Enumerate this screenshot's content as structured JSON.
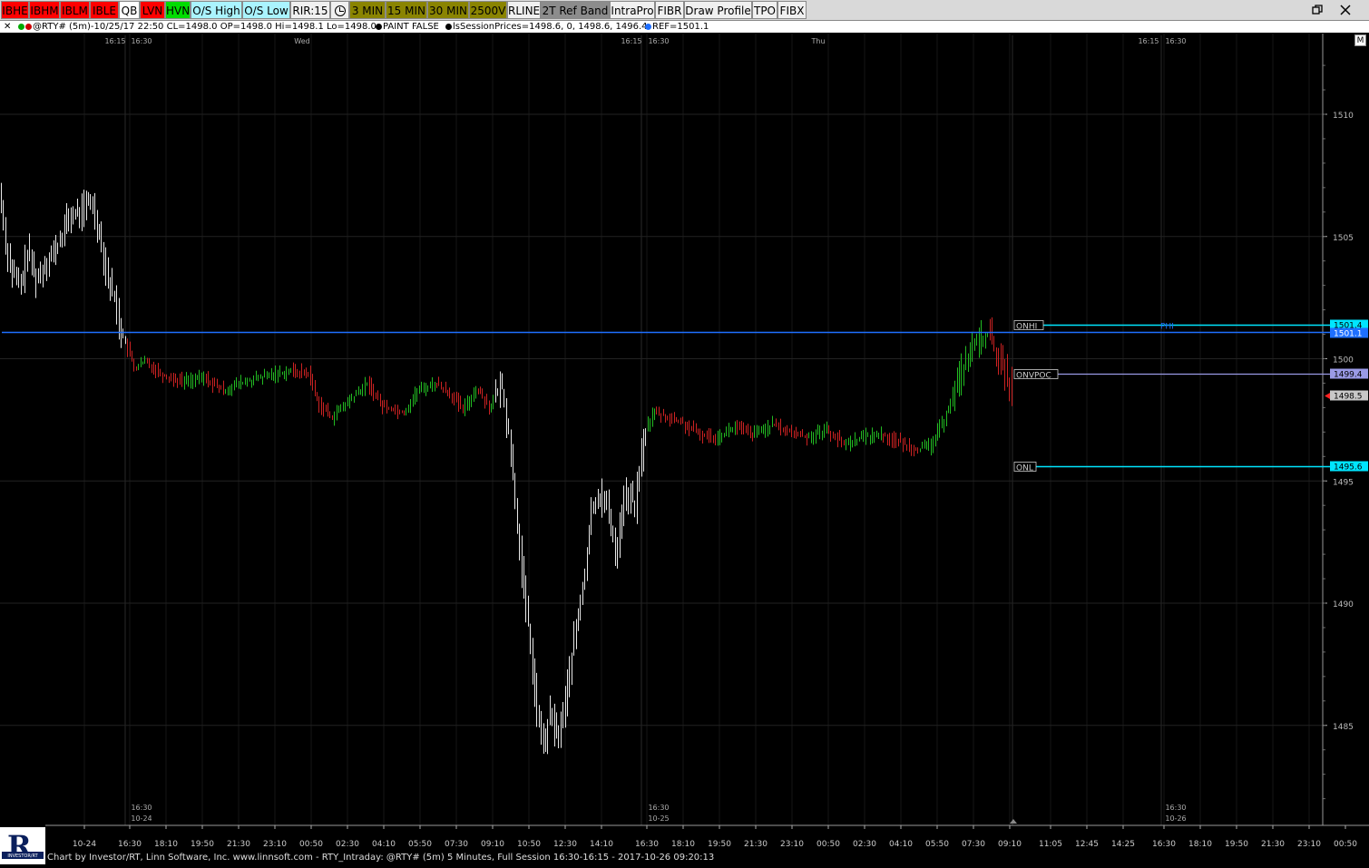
{
  "toolbar": {
    "buttons": [
      {
        "label": "IBHE",
        "bg": "#ff0000",
        "fg": "#000000"
      },
      {
        "label": "IBHM",
        "bg": "#ff0000",
        "fg": "#000000"
      },
      {
        "label": "IBLM",
        "bg": "#ff0000",
        "fg": "#000000"
      },
      {
        "label": "IBLE",
        "bg": "#ff0000",
        "fg": "#000000"
      },
      {
        "label": "QB",
        "bg": "#ffffff",
        "fg": "#000000"
      },
      {
        "label": "LVN",
        "bg": "#ff0000",
        "fg": "#000000"
      },
      {
        "label": "HVN",
        "bg": "#00dd00",
        "fg": "#000000"
      },
      {
        "label": "O/S High",
        "bg": "#aaf4ff",
        "fg": "#000000"
      },
      {
        "label": "O/S Low",
        "bg": "#aaf4ff",
        "fg": "#000000"
      },
      {
        "label": "RIR:15",
        "bg": "#f0f0f0",
        "fg": "#000000"
      },
      {
        "label": "",
        "bg": "#f0f0f0",
        "fg": "#000000",
        "icon": "clock-icon"
      },
      {
        "label": "3 MIN",
        "bg": "#8a8400",
        "fg": "#000000"
      },
      {
        "label": "15 MIN",
        "bg": "#8a8400",
        "fg": "#000000"
      },
      {
        "label": "30 MIN",
        "bg": "#8a8400",
        "fg": "#000000"
      },
      {
        "label": "2500V",
        "bg": "#8a8400",
        "fg": "#000000"
      },
      {
        "label": "RLINE",
        "bg": "#f0f0f0",
        "fg": "#000000"
      },
      {
        "label": "2T Ref Band",
        "bg": "#8c8c8c",
        "fg": "#000000"
      },
      {
        "label": "IntraPro",
        "bg": "#f0f0f0",
        "fg": "#000000"
      },
      {
        "label": "FIBR",
        "bg": "#f0f0f0",
        "fg": "#000000"
      },
      {
        "label": "Draw Profile",
        "bg": "#f0f0f0",
        "fg": "#000000"
      },
      {
        "label": "TPO",
        "bg": "#f0f0f0",
        "fg": "#000000"
      },
      {
        "label": "FIBX",
        "bg": "#f0f0f0",
        "fg": "#000000"
      }
    ],
    "restore_icon": "restore-window-icon",
    "close_icon": "close-icon"
  },
  "infobar": {
    "close_glyph": "✕",
    "symbol_text": "@RTY# (5m)-10/25/17 22:50 CL=1498.0 OP=1498.0 Hi=1498.1 Lo=1498.0",
    "paint_text": "PAINT FALSE",
    "session_text": "lsSessionPrices=1498.6, 0, 1498.6, 1496.4",
    "ref_text": "REF=1501.1"
  },
  "chart_m_button": "M",
  "chart_data": {
    "type": "bar",
    "symbol": "@RTY#",
    "interval": "5 Minutes",
    "y_ticks": [
      1485,
      1490,
      1495,
      1500,
      1505,
      1510
    ],
    "ylim": [
      1481,
      1513
    ],
    "current_price": "1498.5",
    "x_ticks": [
      "10-24",
      "16:30",
      "18:10",
      "19:50",
      "21:30",
      "23:10",
      "00:50",
      "02:30",
      "04:10",
      "05:50",
      "07:30",
      "09:10",
      "10:50",
      "12:30",
      "14:10",
      "16:30",
      "18:10",
      "19:50",
      "21:30",
      "23:10",
      "00:50",
      "02:30",
      "04:10",
      "05:50",
      "07:30",
      "09:10",
      "11:05",
      "12:45",
      "14:25",
      "16:30",
      "18:10",
      "19:50",
      "21:30",
      "23:10",
      "00:50"
    ],
    "top_time_labels": [
      "16:15",
      "16:30",
      "Wed",
      "16:15",
      "16:30",
      "Thu",
      "16:15",
      "16:30"
    ],
    "session_labels": [
      {
        "time": "16:30",
        "date": "10-24"
      },
      {
        "time": "16:30",
        "date": "10-25"
      },
      {
        "time": "16:30",
        "date": "10-26"
      }
    ],
    "levels": [
      {
        "name": "ONHI",
        "value": 1501.4,
        "label": "1501.4",
        "color": "#00e5ff"
      },
      {
        "name": "REF",
        "value": 1501.1,
        "label": "1501.1",
        "color": "#1e6fff"
      },
      {
        "name": "ONVPOC",
        "value": 1499.4,
        "label": "1499.4",
        "color": "#9a9ae6"
      },
      {
        "name": "ONL",
        "value": 1495.6,
        "label": "1495.6",
        "color": "#00e5ff"
      }
    ],
    "phi_label": "PHI",
    "price_path": [
      [
        0,
        1506.8
      ],
      [
        5,
        1504.8
      ],
      [
        12,
        1503.6
      ],
      [
        22,
        1502.9
      ],
      [
        30,
        1504.4
      ],
      [
        40,
        1503.2
      ],
      [
        50,
        1504.0
      ],
      [
        62,
        1504.5
      ],
      [
        75,
        1505.8
      ],
      [
        88,
        1506.0
      ],
      [
        100,
        1506.5
      ],
      [
        110,
        1505.0
      ],
      [
        118,
        1503.3
      ],
      [
        125,
        1502.6
      ],
      [
        132,
        1501.2
      ],
      [
        140,
        1500.4
      ],
      [
        148,
        1499.6
      ],
      [
        160,
        1499.9
      ],
      [
        180,
        1499.3
      ],
      [
        200,
        1499.1
      ],
      [
        225,
        1499.2
      ],
      [
        245,
        1498.7
      ],
      [
        265,
        1499.0
      ],
      [
        285,
        1499.2
      ],
      [
        305,
        1499.4
      ],
      [
        320,
        1499.5
      ],
      [
        340,
        1499.4
      ],
      [
        350,
        1498.2
      ],
      [
        365,
        1497.6
      ],
      [
        385,
        1498.3
      ],
      [
        405,
        1499.0
      ],
      [
        420,
        1498.1
      ],
      [
        445,
        1497.8
      ],
      [
        460,
        1498.7
      ],
      [
        480,
        1499.0
      ],
      [
        495,
        1498.6
      ],
      [
        510,
        1497.9
      ],
      [
        525,
        1498.8
      ],
      [
        540,
        1498.0
      ],
      [
        552,
        1499.0
      ],
      [
        560,
        1497.0
      ],
      [
        568,
        1494.0
      ],
      [
        575,
        1491.0
      ],
      [
        582,
        1489.0
      ],
      [
        590,
        1486.0
      ],
      [
        598,
        1484.0
      ],
      [
        606,
        1485.5
      ],
      [
        614,
        1484.5
      ],
      [
        622,
        1485.8
      ],
      [
        630,
        1488.0
      ],
      [
        638,
        1489.7
      ],
      [
        645,
        1491.5
      ],
      [
        652,
        1494.0
      ],
      [
        660,
        1494.5
      ],
      [
        670,
        1493.8
      ],
      [
        678,
        1492.0
      ],
      [
        688,
        1494.5
      ],
      [
        700,
        1494.0
      ],
      [
        706,
        1496.0
      ],
      [
        712,
        1497.2
      ],
      [
        720,
        1497.8
      ],
      [
        735,
        1497.6
      ],
      [
        750,
        1497.4
      ],
      [
        770,
        1496.9
      ],
      [
        790,
        1496.8
      ],
      [
        810,
        1497.2
      ],
      [
        830,
        1496.9
      ],
      [
        850,
        1497.3
      ],
      [
        870,
        1497.0
      ],
      [
        890,
        1496.8
      ],
      [
        910,
        1497.1
      ],
      [
        930,
        1496.5
      ],
      [
        950,
        1496.8
      ],
      [
        970,
        1496.9
      ],
      [
        990,
        1496.6
      ],
      [
        1010,
        1496.3
      ],
      [
        1025,
        1496.4
      ],
      [
        1040,
        1497.5
      ],
      [
        1052,
        1498.8
      ],
      [
        1065,
        1500.0
      ],
      [
        1078,
        1500.8
      ],
      [
        1090,
        1501.0
      ],
      [
        1100,
        1500.0
      ],
      [
        1110,
        1499.2
      ],
      [
        1116,
        1498.5
      ]
    ]
  },
  "footer": {
    "text": "Chart by Investor/RT, Linn Software, Inc. www.linnsoft.com - RTY_Intraday: @RTY# (5m) 5 Minutes, Full Session 16:30-16:15 - 2017-10-26 09:20:13"
  },
  "logo": {
    "letter": "R",
    "ribbon_text": "INVESTOR/RT"
  }
}
